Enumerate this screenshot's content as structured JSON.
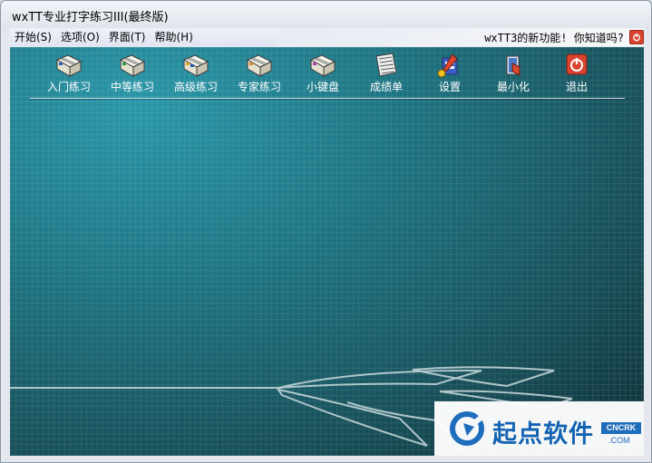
{
  "window": {
    "title": "wxTT专业打字练习III(最终版)"
  },
  "menu": {
    "items": [
      {
        "label": "开始(S)"
      },
      {
        "label": "选项(O)"
      },
      {
        "label": "界面(T)"
      },
      {
        "label": "帮助(H)"
      }
    ],
    "notice": "wxTT3的新功能! 你知道吗?",
    "close_icon": "power-icon"
  },
  "toolbar": {
    "items": [
      {
        "label": "入门练习",
        "icon": "book-icon"
      },
      {
        "label": "中等练习",
        "icon": "book-icon"
      },
      {
        "label": "高级练习",
        "icon": "book-icon"
      },
      {
        "label": "专家练习",
        "icon": "book-icon"
      },
      {
        "label": "小键盘",
        "icon": "book-icon"
      },
      {
        "label": "成绩单",
        "icon": "report-icon"
      },
      {
        "label": "设置",
        "icon": "settings-icon"
      },
      {
        "label": "最小化",
        "icon": "minimize-icon"
      },
      {
        "label": "退出",
        "icon": "exit-icon"
      }
    ]
  },
  "watermark": {
    "text": "起点软件",
    "badge": "CNCRK",
    "sub": ".COM"
  },
  "colors": {
    "background": "#1c6774",
    "exit_red": "#d9432f",
    "label": "#ffffff"
  }
}
